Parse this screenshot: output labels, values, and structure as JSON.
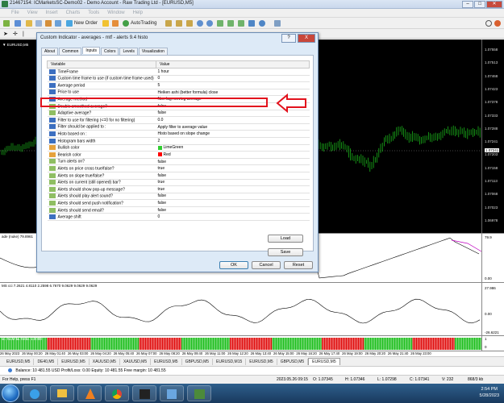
{
  "window": {
    "title": "21467154: ICMarketsSC-Demo02 - Demo Account - Raw Trading Ltd - [EURUSD,M5]"
  },
  "menu": [
    "File",
    "View",
    "Insert",
    "Charts",
    "Tools",
    "Window",
    "Help"
  ],
  "toolbar": {
    "new_order": "New Order",
    "autotrading": "AutoTrading"
  },
  "chart": {
    "symbol_label": "▼ EURUSD,M5",
    "price_labels": [
      "1.07558",
      "1.07513",
      "1.07468",
      "1.07423",
      "1.07378",
      "1.07333",
      "1.07288",
      "1.07241",
      "1.07203",
      "1.07158",
      "1.07113",
      "1.07068",
      "1.07023",
      "1.06978"
    ],
    "current_price": "1.07241"
  },
  "subwindows": {
    "sub1_label": "ade (nuke) 79.8961",
    "sub1_axis": [
      "79.9",
      "0.00"
    ],
    "sub2_label": "MS cci 7.2621 4.8110 2.2598 6.7670 9.0629 9.0629 9.0629",
    "sub2_axis": [
      "27.986",
      "0.00",
      "-26.6221"
    ],
    "sub3_label": "sc. NLM ta. histo. 1.0000",
    "sub3_axis": [
      "1",
      "0"
    ]
  },
  "time_labels": [
    "26 May 2023",
    "26 May 00:20",
    "26 May 01:40",
    "26 May 03:00",
    "26 May 04:20",
    "26 May 05:40",
    "26 May 07:00",
    "26 May 08:20",
    "26 May 09:40",
    "26 May 11:00",
    "26 May 12:20",
    "26 May 13:40",
    "26 May 15:00",
    "26 May 16:20",
    "26 May 17:40",
    "26 May 19:00",
    "26 May 20:20",
    "26 May 21:40",
    "26 May 23:00"
  ],
  "symbol_tabs": [
    "EURUSD,M5",
    "DE40,M5",
    "EURUSD,M5",
    "XAUUSD,M5",
    "XAUUSD,M5",
    "EURUSD,M5",
    "GBPUSD,M5",
    "EURUSD,M15",
    "EURUSD,M5",
    "GBPUSD,M5",
    "EURUSD,M5"
  ],
  "balance_line": "Balance: 10 481.55 USD  Profit/Loss: 0.00  Equity: 10 481.55  Free margin: 10 481.55",
  "status": {
    "help": "For Help, press F1",
    "datetime": "2023.05.26 09:15",
    "open": "O: 1.07345",
    "high": "H: 1.07346",
    "low": "L: 1.07298",
    "close": "C: 1.07341",
    "volume": "V: 232",
    "traffic": "868/3 kb"
  },
  "clock": {
    "time": "2:54 PM",
    "date": "5/28/2023"
  },
  "dialog": {
    "title": "Custom Indicator - averages - mtf - alerts 9.4 histo",
    "help_btn": "?",
    "close_btn": "X",
    "tabs": [
      "About",
      "Common",
      "Inputs",
      "Colors",
      "Levels",
      "Visualization"
    ],
    "active_tab": "Inputs",
    "columns": [
      "Variable",
      "Value"
    ],
    "rows": [
      {
        "icon": "val",
        "name": "TimeFrame",
        "value": "1 hour"
      },
      {
        "icon": "val",
        "name": "Custom time frame to use (if custom time frame used)",
        "value": "0"
      },
      {
        "icon": "val",
        "name": "Average period",
        "value": "5"
      },
      {
        "icon": "val",
        "name": "Price to use",
        "value": "Heiken ashi (better formula) close"
      },
      {
        "icon": "val",
        "name": "Average method",
        "value": "Non lag moving average"
      },
      {
        "icon": "bool",
        "name": "Double smoothed average?",
        "value": "false"
      },
      {
        "icon": "bool",
        "name": "Adaptive average?",
        "value": "false"
      },
      {
        "icon": "val",
        "name": "Filter to use for filtering (<=0 for no filtering)",
        "value": "0.0"
      },
      {
        "icon": "val",
        "name": "Filter should be applied to :",
        "value": "Apply filter to average value"
      },
      {
        "icon": "val",
        "name": "Histo based on :",
        "value": "Histo based on slope change"
      },
      {
        "icon": "val",
        "name": "Histogram bars width",
        "value": "2"
      },
      {
        "icon": "color",
        "name": "Bullish color",
        "value": "LimeGreen",
        "swatch": "#32cd32"
      },
      {
        "icon": "color",
        "name": "Bearish color",
        "value": "Red",
        "swatch": "#ff0000"
      },
      {
        "icon": "bool",
        "name": "Turn alerts on?",
        "value": "false"
      },
      {
        "icon": "bool",
        "name": "Alerts on price cross true/false?",
        "value": "true"
      },
      {
        "icon": "bool",
        "name": "Alerts on slope true/false?",
        "value": "false"
      },
      {
        "icon": "bool",
        "name": "Alerts on current (still opened) bar?",
        "value": "true"
      },
      {
        "icon": "bool",
        "name": "Alerts should show pop-up message?",
        "value": "true"
      },
      {
        "icon": "bool",
        "name": "Alerts should play alert sound?",
        "value": "false"
      },
      {
        "icon": "bool",
        "name": "Alerts should send push notification?",
        "value": "false"
      },
      {
        "icon": "bool",
        "name": "Alerts should send email?",
        "value": "false"
      },
      {
        "icon": "val",
        "name": "Average shift",
        "value": "0"
      }
    ],
    "load_btn": "Load",
    "save_btn": "Save",
    "ok_btn": "OK",
    "cancel_btn": "Cancel",
    "reset_btn": "Reset"
  }
}
